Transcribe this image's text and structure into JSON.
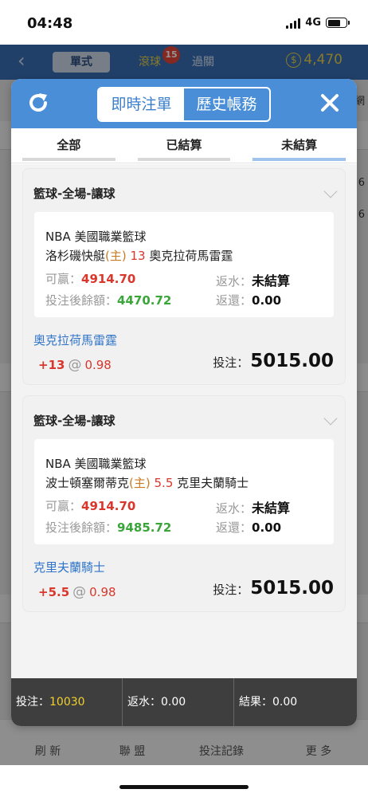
{
  "status_bar": {
    "time": "04:48",
    "network": "4G"
  },
  "background": {
    "tabs": [
      "單式",
      "滾球",
      "過關"
    ],
    "live_badge": "15",
    "balance": "4,470",
    "edge_texts": [
      "網",
      "6",
      "6"
    ],
    "tabbar": [
      "刷 新",
      "聯 盟",
      "投注記錄",
      "更 多"
    ]
  },
  "modal": {
    "segments": {
      "active": "即時注單",
      "inactive": "歷史帳務"
    },
    "filters": [
      "全部",
      "已結算",
      "未結算"
    ],
    "active_filter": "未結算",
    "labels": {
      "win": "可贏：",
      "balance_after": "投注後餘額：",
      "rebate": "返水：",
      "return": "返還：",
      "at": "@",
      "stake": "投注："
    },
    "bets": [
      {
        "title": "籃球-全場-讓球",
        "league": "NBA 美國職業籃球",
        "home": "洛杉磯快艇",
        "home_mark": "(主)",
        "handicap": "13",
        "away": "奧克拉荷馬雷霆",
        "win": "4914.70",
        "balance_after": "4470.72",
        "rebate": "未結算",
        "return": "0.00",
        "pick_team": "奧克拉荷馬雷霆",
        "pick_handicap": "+13",
        "odds": "0.98",
        "stake": "5015.00"
      },
      {
        "title": "籃球-全場-讓球",
        "league": "NBA 美國職業籃球",
        "home": "波士頓塞爾蒂克",
        "home_mark": "(主)",
        "handicap": "5.5",
        "away": "克里夫蘭騎士",
        "win": "4914.70",
        "balance_after": "9485.72",
        "rebate": "未結算",
        "return": "0.00",
        "pick_team": "克里夫蘭騎士",
        "pick_handicap": "+5.5",
        "odds": "0.98",
        "stake": "5015.00"
      }
    ],
    "summary": {
      "stake_label": "投注：",
      "stake_value": "10030",
      "rebate_label": "返水：",
      "rebate_value": "0.00",
      "result_label": "結果：",
      "result_value": "0.00"
    }
  },
  "colors": {
    "header_blue": "#4a8ed8",
    "nav_blue": "#3a6fb5",
    "win_red": "#d9372b",
    "balance_green": "#3aa63a",
    "pick_blue": "#2f74c9",
    "summary_yellow": "#f0d02f"
  }
}
